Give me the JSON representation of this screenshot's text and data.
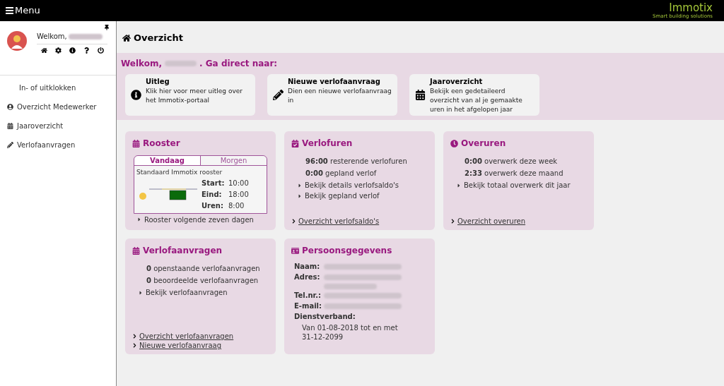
{
  "topbar": {
    "menu_label": "Menu",
    "logo_name": "Immotix",
    "logo_tagline": "Smart building solutions"
  },
  "sidebar": {
    "greeting": "Welkom,",
    "items": [
      {
        "kind": "plain",
        "label": "In- of uitklokken"
      },
      {
        "kind": "user",
        "label": "Overzicht Medewerker"
      },
      {
        "kind": "calendar",
        "label": "Jaaroverzicht"
      },
      {
        "kind": "pencil",
        "label": "Verlofaanvragen"
      }
    ]
  },
  "page_title": "Overzicht",
  "welcome": {
    "prefix": "Welkom,",
    "suffix": ". Ga direct naar:",
    "shortcuts": [
      {
        "kind": "info",
        "title": "Uitleg",
        "text": "Klik hier voor meer uitleg over het Immotix-portaal"
      },
      {
        "kind": "pencil",
        "title": "Nieuwe verlofaanvraag",
        "text": "Dien een nieuwe verlofaanvraag in"
      },
      {
        "kind": "calendar",
        "title": "Jaaroverzicht",
        "text": "Bekijk een gedetaileerd overzicht van al je gemaakte uren in het afgelopen jaar"
      }
    ]
  },
  "rooster": {
    "title": "Rooster",
    "tabs": [
      {
        "label": "Vandaag",
        "selected": true
      },
      {
        "label": "Morgen",
        "selected": false
      }
    ],
    "schedule_name": "Standaard Immotix rooster",
    "rows": [
      {
        "label": "Start:",
        "value": "10:00"
      },
      {
        "label": "Eind:",
        "value": "18:00"
      },
      {
        "label": "Uren:",
        "value": "8:00"
      }
    ],
    "link": "Rooster volgende zeven dagen"
  },
  "cards": [
    {
      "kind": "calendar_check",
      "title": "Verlofuren",
      "stats": [
        "**96:00** resterende verlofuren",
        "**0:00** gepland verlof"
      ],
      "links": [
        "Bekijk details verlofsaldo's",
        "Bekijk gepland verlof"
      ],
      "footer_links": [
        "Overzicht verlofsaldo's"
      ]
    },
    {
      "kind": "clock",
      "title": "Overuren",
      "stats": [
        "**0:00** overwerk deze week",
        "**2:33** overwerk deze maand"
      ],
      "links": [
        "Bekijk totaal overwerk dit jaar"
      ],
      "footer_links": [
        "Overzicht overuren"
      ]
    },
    {
      "kind": "calendar",
      "title": "Verlofaanvragen",
      "stats": [
        "**0** openstaande verlofaanvragen",
        "**0** beoordeelde verlofaanvragen"
      ],
      "links": [
        "Bekijk verlofaanvragen"
      ],
      "footer_links": [
        "Overzicht verlofaanvragen",
        "Nieuwe verlofaanvraag"
      ]
    }
  ],
  "personal": {
    "title": "Persoonsgegevens",
    "fields": [
      {
        "label": "Naam:",
        "kind": "single"
      },
      {
        "label": "Adres:",
        "kind": "double"
      },
      {
        "label": "Tel.nr.:",
        "kind": "single"
      },
      {
        "label": "E-mail:",
        "kind": "single"
      }
    ],
    "contract_label": "Dienstverband:",
    "contract_text": "Van 01-08-2018 tot en met 31-12-2099"
  }
}
